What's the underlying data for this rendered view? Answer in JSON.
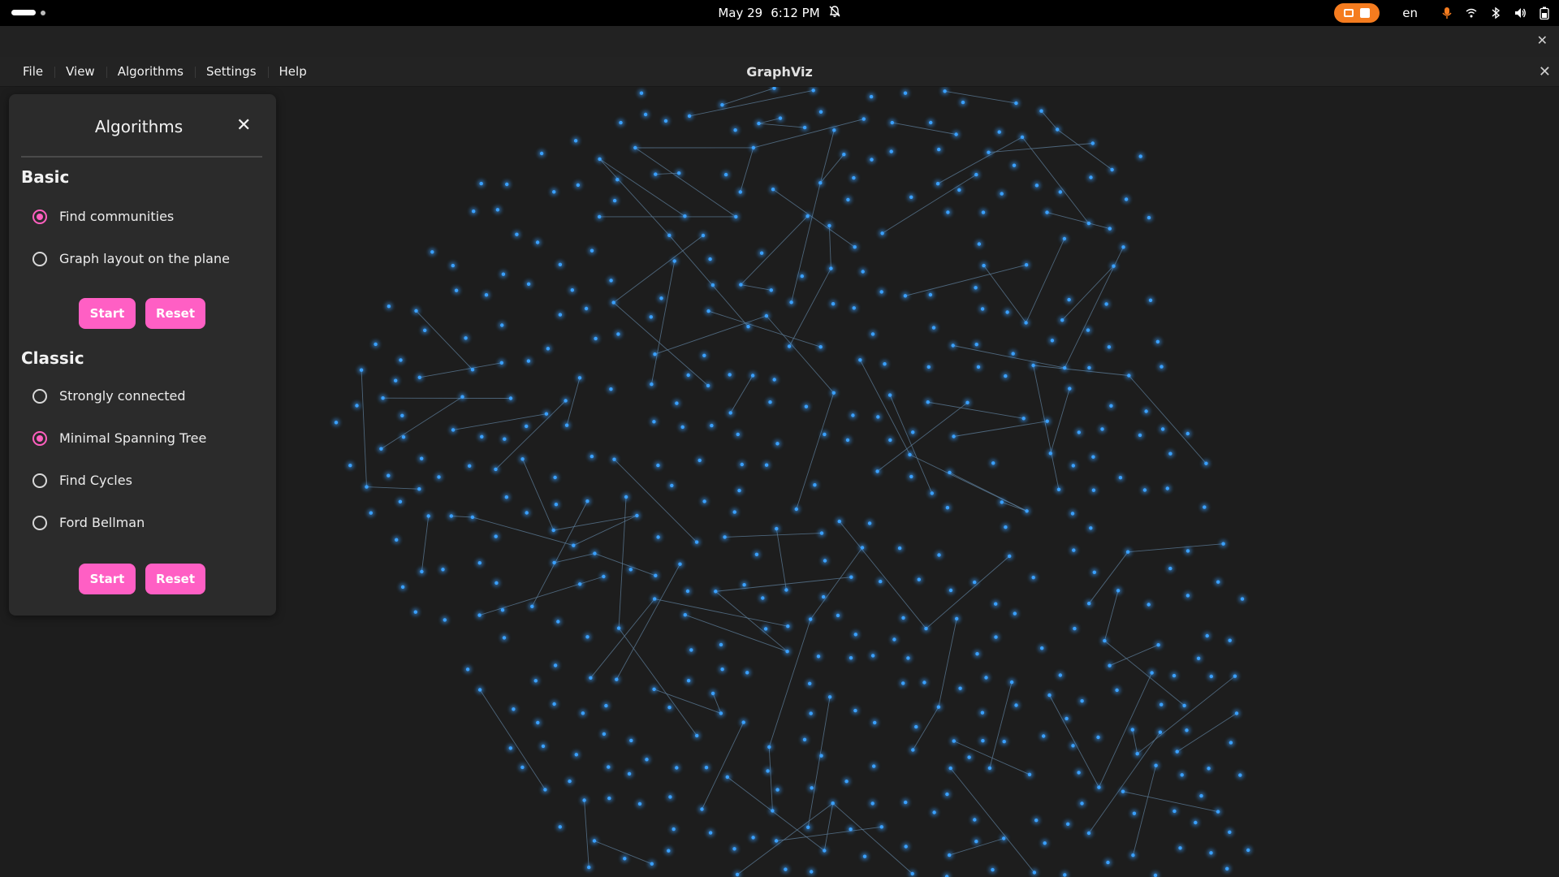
{
  "system_bar": {
    "date": "May 29",
    "time": "6:12 PM",
    "language": "en",
    "icons": [
      "notifications-off-icon",
      "screencast-icon",
      "stop-recording-icon",
      "microphone-icon",
      "network-icon",
      "bluetooth-icon",
      "volume-icon",
      "battery-icon"
    ],
    "accent_color": "#f57c1f"
  },
  "menubar": {
    "items": [
      {
        "label": "File"
      },
      {
        "label": "View"
      },
      {
        "label": "Algorithms"
      },
      {
        "label": "Settings"
      },
      {
        "label": "Help"
      }
    ],
    "app_title": "GraphViz"
  },
  "panel": {
    "title": "Algorithms",
    "accent_color": "#ff5fc4",
    "basic": {
      "title": "Basic",
      "options": [
        {
          "label": "Find communities",
          "selected": true
        },
        {
          "label": "Graph layout on the plane",
          "selected": false
        }
      ],
      "start_label": "Start",
      "reset_label": "Reset"
    },
    "classic": {
      "title": "Classic",
      "options": [
        {
          "label": "Strongly connected",
          "selected": false
        },
        {
          "label": "Minimal Spanning Tree",
          "selected": true
        },
        {
          "label": "Find Cycles",
          "selected": false
        },
        {
          "label": "Ford Bellman",
          "selected": false
        }
      ],
      "start_label": "Start",
      "reset_label": "Reset"
    }
  },
  "graph": {
    "node_color": "#3aa0ff",
    "edge_color": "#5d7d99"
  }
}
